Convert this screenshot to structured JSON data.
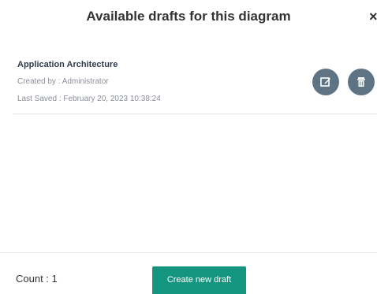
{
  "dialog": {
    "title": "Available drafts for this diagram",
    "close_label": "×"
  },
  "drafts": [
    {
      "name": "Application Architecture",
      "created_by": "Created by : Administrator",
      "last_saved": "Last Saved : February 20, 2023 10:38:24",
      "edit_icon": "edit-icon",
      "delete_icon": "trash-icon"
    }
  ],
  "footer": {
    "count": "Count : 1",
    "create_button": "Create new draft"
  },
  "colors": {
    "accent": "#14957f",
    "icon_button": "#5e7484"
  }
}
